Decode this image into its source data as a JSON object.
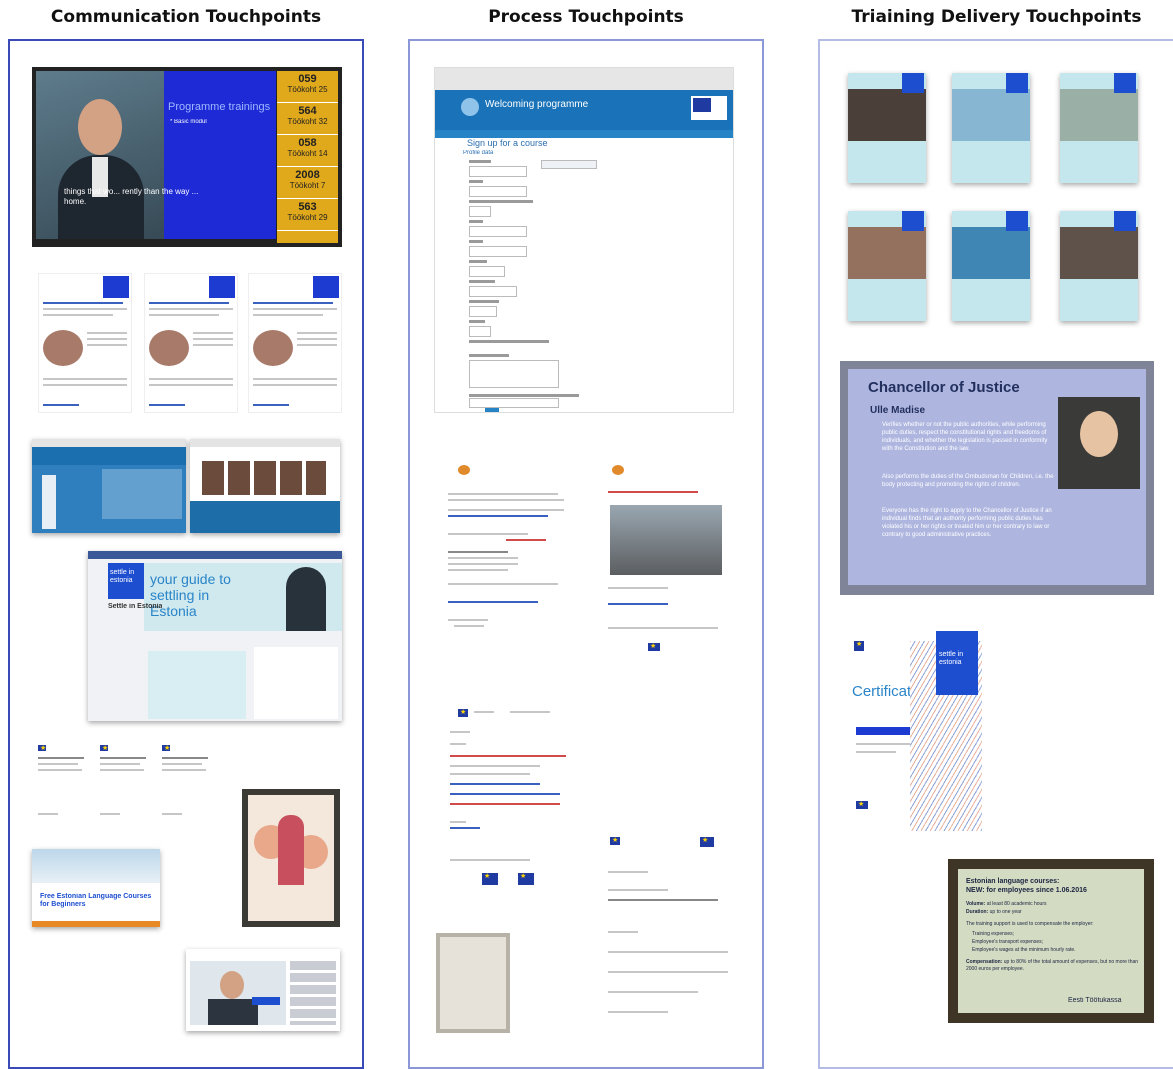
{
  "columns": [
    {
      "title": "Communication Touchpoints"
    },
    {
      "title": "Process Touchpoints"
    },
    {
      "title": "Triaining Delivery Touchpoints"
    }
  ],
  "communication": {
    "tv_screen": {
      "heading": "Programme trainings",
      "bullet": "* Basic modul",
      "caption": "things that wo... rently than the way ... home.",
      "queue": [
        {
          "number": "059",
          "label": "Töökoht 25"
        },
        {
          "number": "564",
          "label": "Töökoht 32"
        },
        {
          "number": "058",
          "label": "Töökoht 14"
        },
        {
          "number": "2008",
          "label": "Töökoht 7"
        },
        {
          "number": "563",
          "label": "Töökoht 29"
        }
      ]
    },
    "facebook": {
      "tagline": "your guide to settling in Estonia",
      "page_name": "Settle in Estonia",
      "logo": "settle in estonia"
    },
    "course_flyer": {
      "title": "Free Estonian Language Courses for Beginners"
    }
  },
  "process": {
    "signup_site": {
      "title": "Welcoming programme",
      "form_title": "Sign up for a course",
      "section": "Profile data"
    }
  },
  "delivery": {
    "slide_chancellor": {
      "title": "Chancellor of Justice",
      "name": "Ülle Madise",
      "bullets": [
        "Verifies whether or not the public authorities, while performing public duties, respect the constitutional rights and freedoms of individuals, and whether the legislation is passed in conformity with the Constitution and the law.",
        "Also performs the duties of the Ombudsman for Children, i.e. the body protecting and promoting the rights of children.",
        "Everyone has the right to apply to the Chancellor of Justice if an individual finds that an authority performing public duties has violated his or her rights or treated him or her contrary to law or contrary to good administrative practices."
      ]
    },
    "certificate": {
      "title": "Certificate",
      "logo": "settle in estonia"
    },
    "slide_language": {
      "title_line1": "Estonian language courses:",
      "title_line2": "NEW: for employees since 1.06.2016",
      "volume_label": "Volume:",
      "volume_value": "at least 80 academic hours",
      "duration_label": "Duration:",
      "duration_value": "up to one year",
      "support_text": "The training support is used to compensate the employer:",
      "bullets": [
        "Training expenses;",
        "Employee's transport expenses;",
        "Employee's wages at the minimum hourly rate."
      ],
      "compensation_label": "Compensation:",
      "compensation_value": "up to 80% of the total amount of expenses, but no more than 2000 euros per employee.",
      "logo": "Eesti Töötukassa"
    }
  },
  "colors": {
    "column_border": "#3a4bb8",
    "brand_blue": "#1a73b8",
    "light_teal": "#bfe4ec"
  }
}
